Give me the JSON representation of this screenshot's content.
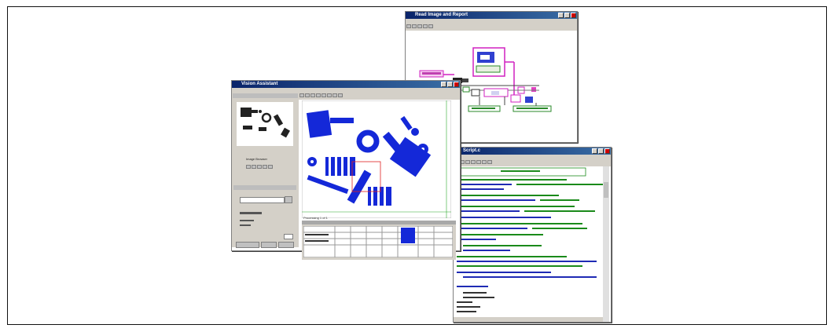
{
  "windows": {
    "diagram": {
      "title": "Read Image and Report"
    },
    "vision": {
      "title": "Vision Assistant",
      "status_text": "Processing 1 of 1",
      "thumb_caption": "Image Browser"
    },
    "code": {
      "title": "Script.c"
    }
  },
  "colors": {
    "accent_blue": "#1428d8",
    "wire_pink": "#d020c0",
    "code_green": "#1a8a1a",
    "code_blue": "#1e2ab4"
  }
}
